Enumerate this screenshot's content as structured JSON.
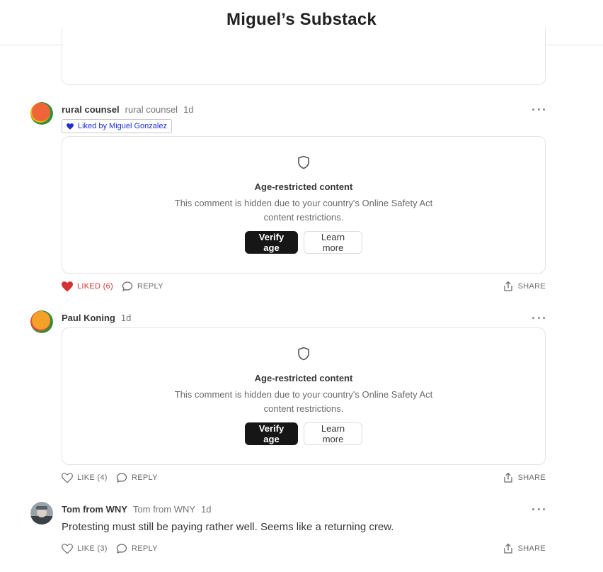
{
  "publication": {
    "title": "Miguel’s Substack"
  },
  "comments": [
    {
      "author": "rural counsel",
      "handle": "rural counsel",
      "time": "1d",
      "liked_by": "Liked by Miguel Gonzalez",
      "restricted": {
        "title": "Age-restricted content",
        "desc_line1": "This comment is hidden due to your country's Online Safety Act",
        "desc_line2": "content restrictions.",
        "verify_label": "Verify age",
        "learn_label": "Learn more"
      },
      "like_label": "LIKED (6)",
      "reply_label": "REPLY",
      "share_label": "SHARE"
    },
    {
      "author": "Paul Koning",
      "time": "1d",
      "restricted": {
        "title": "Age-restricted content",
        "desc_line1": "This comment is hidden due to your country's Online Safety Act",
        "desc_line2": "content restrictions.",
        "verify_label": "Verify age",
        "learn_label": "Learn more"
      },
      "like_label": "LIKE (4)",
      "reply_label": "REPLY",
      "share_label": "SHARE"
    },
    {
      "author": "Tom from WNY",
      "handle": "Tom from WNY",
      "time": "1d",
      "text": "Protesting must still be paying rather well. Seems like a returning crew.",
      "like_label": "LIKE (3)",
      "reply_label": "REPLY",
      "share_label": "SHARE"
    }
  ],
  "colors": {
    "liked": "#d23434",
    "badge_text": "#1d2fd6",
    "dark_button": "#161616",
    "avatar_1": "#f0643a",
    "avatar_2": "#f4a227"
  },
  "icons": [
    "shield-icon",
    "heart-icon",
    "comment-bubble-icon",
    "share-icon",
    "more-dots-icon"
  ]
}
